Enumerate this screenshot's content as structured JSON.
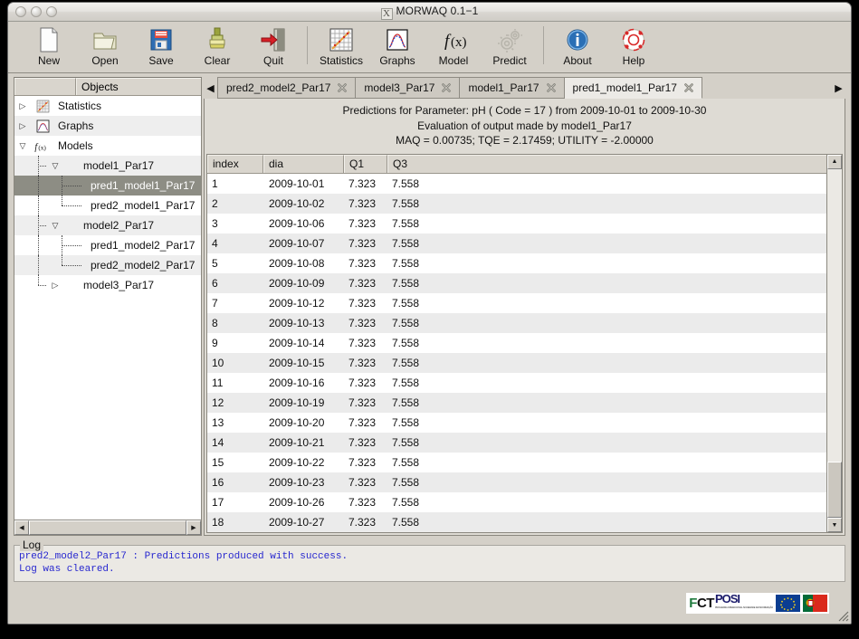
{
  "window": {
    "title": "MORWAQ 0.1−1",
    "x11_glyph": "X",
    "buttons": [
      "close-button",
      "minimize-button",
      "zoom-button"
    ]
  },
  "toolbar": {
    "items": [
      {
        "label": "New",
        "icon": "new-document-icon"
      },
      {
        "label": "Open",
        "icon": "open-folder-icon"
      },
      {
        "label": "Save",
        "icon": "floppy-disk-icon"
      },
      {
        "label": "Clear",
        "icon": "paint-brush-icon"
      },
      {
        "label": "Quit",
        "icon": "exit-door-icon"
      },
      {
        "label": "Statistics",
        "icon": "statistics-grid-icon"
      },
      {
        "label": "Graphs",
        "icon": "bell-curve-icon"
      },
      {
        "label": "Model",
        "icon": "function-fx-icon"
      },
      {
        "label": "Predict",
        "icon": "gears-icon"
      },
      {
        "label": "About",
        "icon": "info-circle-icon"
      },
      {
        "label": "Help",
        "icon": "lifebuoy-icon"
      }
    ]
  },
  "tree": {
    "header_blank": "",
    "header_objects": "Objects",
    "rows": [
      {
        "label": "Statistics",
        "depth": 0,
        "toggle": "collapsed",
        "icon": "statistics-grid-icon"
      },
      {
        "label": "Graphs",
        "depth": 0,
        "toggle": "collapsed",
        "icon": "bell-curve-icon"
      },
      {
        "label": "Models",
        "depth": 0,
        "toggle": "expanded",
        "icon": "function-fx-icon"
      },
      {
        "label": "model1_Par17",
        "depth": 1,
        "toggle": "expanded",
        "icon": ""
      },
      {
        "label": "pred1_model1_Par17",
        "depth": 2,
        "toggle": "leaf",
        "icon": "",
        "selected": true
      },
      {
        "label": "pred2_model1_Par17",
        "depth": 2,
        "toggle": "leaf",
        "icon": ""
      },
      {
        "label": "model2_Par17",
        "depth": 1,
        "toggle": "expanded",
        "icon": ""
      },
      {
        "label": "pred1_model2_Par17",
        "depth": 2,
        "toggle": "leaf",
        "icon": ""
      },
      {
        "label": "pred2_model2_Par17",
        "depth": 2,
        "toggle": "leaf",
        "icon": ""
      },
      {
        "label": "model3_Par17",
        "depth": 1,
        "toggle": "collapsed",
        "icon": ""
      }
    ]
  },
  "tabs": {
    "prev_label": "◀",
    "next_label": "▶",
    "items": [
      {
        "label": "pred2_model2_Par17",
        "active": false
      },
      {
        "label": "model3_Par17",
        "active": false
      },
      {
        "label": "model1_Par17",
        "active": false
      },
      {
        "label": "pred1_model1_Par17",
        "active": true
      }
    ]
  },
  "content": {
    "header_lines": [
      "Predictions for Parameter: pH ( Code = 17 ) from 2009-10-01 to 2009-10-30",
      "Evaluation of output made by model1_Par17",
      "MAQ =  0.00735; TQE =  2.17459; UTILITY = -2.00000"
    ],
    "table": {
      "columns": [
        "index",
        "dia",
        "Q1",
        "Q3"
      ],
      "rows": [
        [
          "1",
          "2009-10-01",
          "7.323",
          "7.558"
        ],
        [
          "2",
          "2009-10-02",
          "7.323",
          "7.558"
        ],
        [
          "3",
          "2009-10-06",
          "7.323",
          "7.558"
        ],
        [
          "4",
          "2009-10-07",
          "7.323",
          "7.558"
        ],
        [
          "5",
          "2009-10-08",
          "7.323",
          "7.558"
        ],
        [
          "6",
          "2009-10-09",
          "7.323",
          "7.558"
        ],
        [
          "7",
          "2009-10-12",
          "7.323",
          "7.558"
        ],
        [
          "8",
          "2009-10-13",
          "7.323",
          "7.558"
        ],
        [
          "9",
          "2009-10-14",
          "7.323",
          "7.558"
        ],
        [
          "10",
          "2009-10-15",
          "7.323",
          "7.558"
        ],
        [
          "11",
          "2009-10-16",
          "7.323",
          "7.558"
        ],
        [
          "12",
          "2009-10-19",
          "7.323",
          "7.558"
        ],
        [
          "13",
          "2009-10-20",
          "7.323",
          "7.558"
        ],
        [
          "14",
          "2009-10-21",
          "7.323",
          "7.558"
        ],
        [
          "15",
          "2009-10-22",
          "7.323",
          "7.558"
        ],
        [
          "16",
          "2009-10-23",
          "7.323",
          "7.558"
        ],
        [
          "17",
          "2009-10-26",
          "7.323",
          "7.558"
        ],
        [
          "18",
          "2009-10-27",
          "7.323",
          "7.558"
        ]
      ]
    }
  },
  "log": {
    "legend": "Log",
    "lines": [
      "pred2_model2_Par17 : Predictions produced with success.",
      "Log was cleared."
    ]
  },
  "footer": {
    "logos": [
      {
        "name": "fct-logo",
        "text": "FCT"
      },
      {
        "name": "posi-logo",
        "text": "POSI",
        "sub": "PROGRAMA OPERACIONAL SOCIEDADE DA INFORMAÇÃO"
      },
      {
        "name": "eu-flag-logo",
        "text": ""
      },
      {
        "name": "portugal-flag-logo",
        "text": ""
      }
    ]
  },
  "colors": {
    "window_bg": "#d4d0c8",
    "selection": "#8d8d84",
    "log_text": "#2727cf",
    "table_alt_row": "#ebebeb",
    "accent_blue": "#2b6fb5"
  }
}
